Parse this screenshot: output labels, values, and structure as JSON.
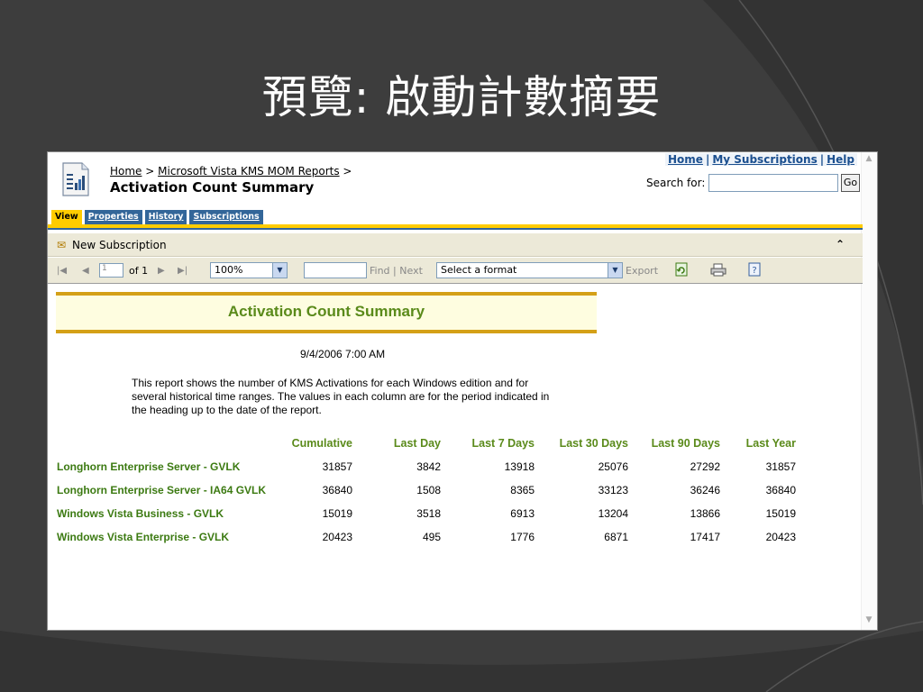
{
  "slide": {
    "title": "預覽: 啟動計數摘要"
  },
  "header": {
    "breadcrumb_home": "Home",
    "breadcrumb_sep1": " > ",
    "breadcrumb_folder": "Microsoft Vista KMS MOM Reports",
    "breadcrumb_sep2": " >",
    "page_title": "Activation Count Summary",
    "links": {
      "home": "Home",
      "subscriptions": "My Subscriptions",
      "help": "Help",
      "separator": "|"
    },
    "search_label": "Search for:",
    "search_value": "",
    "go_label": "Go"
  },
  "tabs": [
    {
      "label": "View",
      "active": true
    },
    {
      "label": "Properties",
      "active": false
    },
    {
      "label": "History",
      "active": false
    },
    {
      "label": "Subscriptions",
      "active": false
    }
  ],
  "subscription_bar": {
    "new_subscription_label": "New Subscription"
  },
  "toolbar": {
    "page_value": "1",
    "of_label": "of 1",
    "zoom_value": "100%",
    "find_value": "",
    "find_label": "Find",
    "find_sep": "|",
    "next_label": "Next",
    "format_value": "Select a format",
    "export_label": "Export"
  },
  "report": {
    "title": "Activation Count Summary",
    "date": "9/4/2006 7:00 AM",
    "description": "This report shows the number of KMS Activations for each Windows edition and for several historical time ranges. The values in each column are for the period indicated in the heading up to the date of the report.",
    "columns": [
      "",
      "Cumulative",
      "Last Day",
      "Last 7 Days",
      "Last 30 Days",
      "Last 90 Days",
      "Last Year"
    ],
    "rows": [
      [
        "Longhorn Enterprise Server - GVLK",
        "31857",
        "3842",
        "13918",
        "25076",
        "27292",
        "31857"
      ],
      [
        "Longhorn Enterprise Server - IA64 GVLK",
        "36840",
        "1508",
        "8365",
        "33123",
        "36246",
        "36840"
      ],
      [
        "Windows Vista Business - GVLK",
        "15019",
        "3518",
        "6913",
        "13204",
        "13866",
        "15019"
      ],
      [
        "Windows Vista Enterprise - GVLK",
        "20423",
        "495",
        "1776",
        "6871",
        "17417",
        "20423"
      ]
    ]
  },
  "colors": {
    "tab_blue": "#336699",
    "tab_active": "#ffcc00",
    "report_green": "#5a8a1a",
    "band_gold": "#d4a017"
  },
  "icons": [
    "report-icon",
    "new-subscription-icon",
    "collapse-icon",
    "first-page-icon",
    "prev-page-icon",
    "next-page-icon",
    "last-page-icon",
    "refresh-icon",
    "print-icon",
    "help-icon"
  ]
}
